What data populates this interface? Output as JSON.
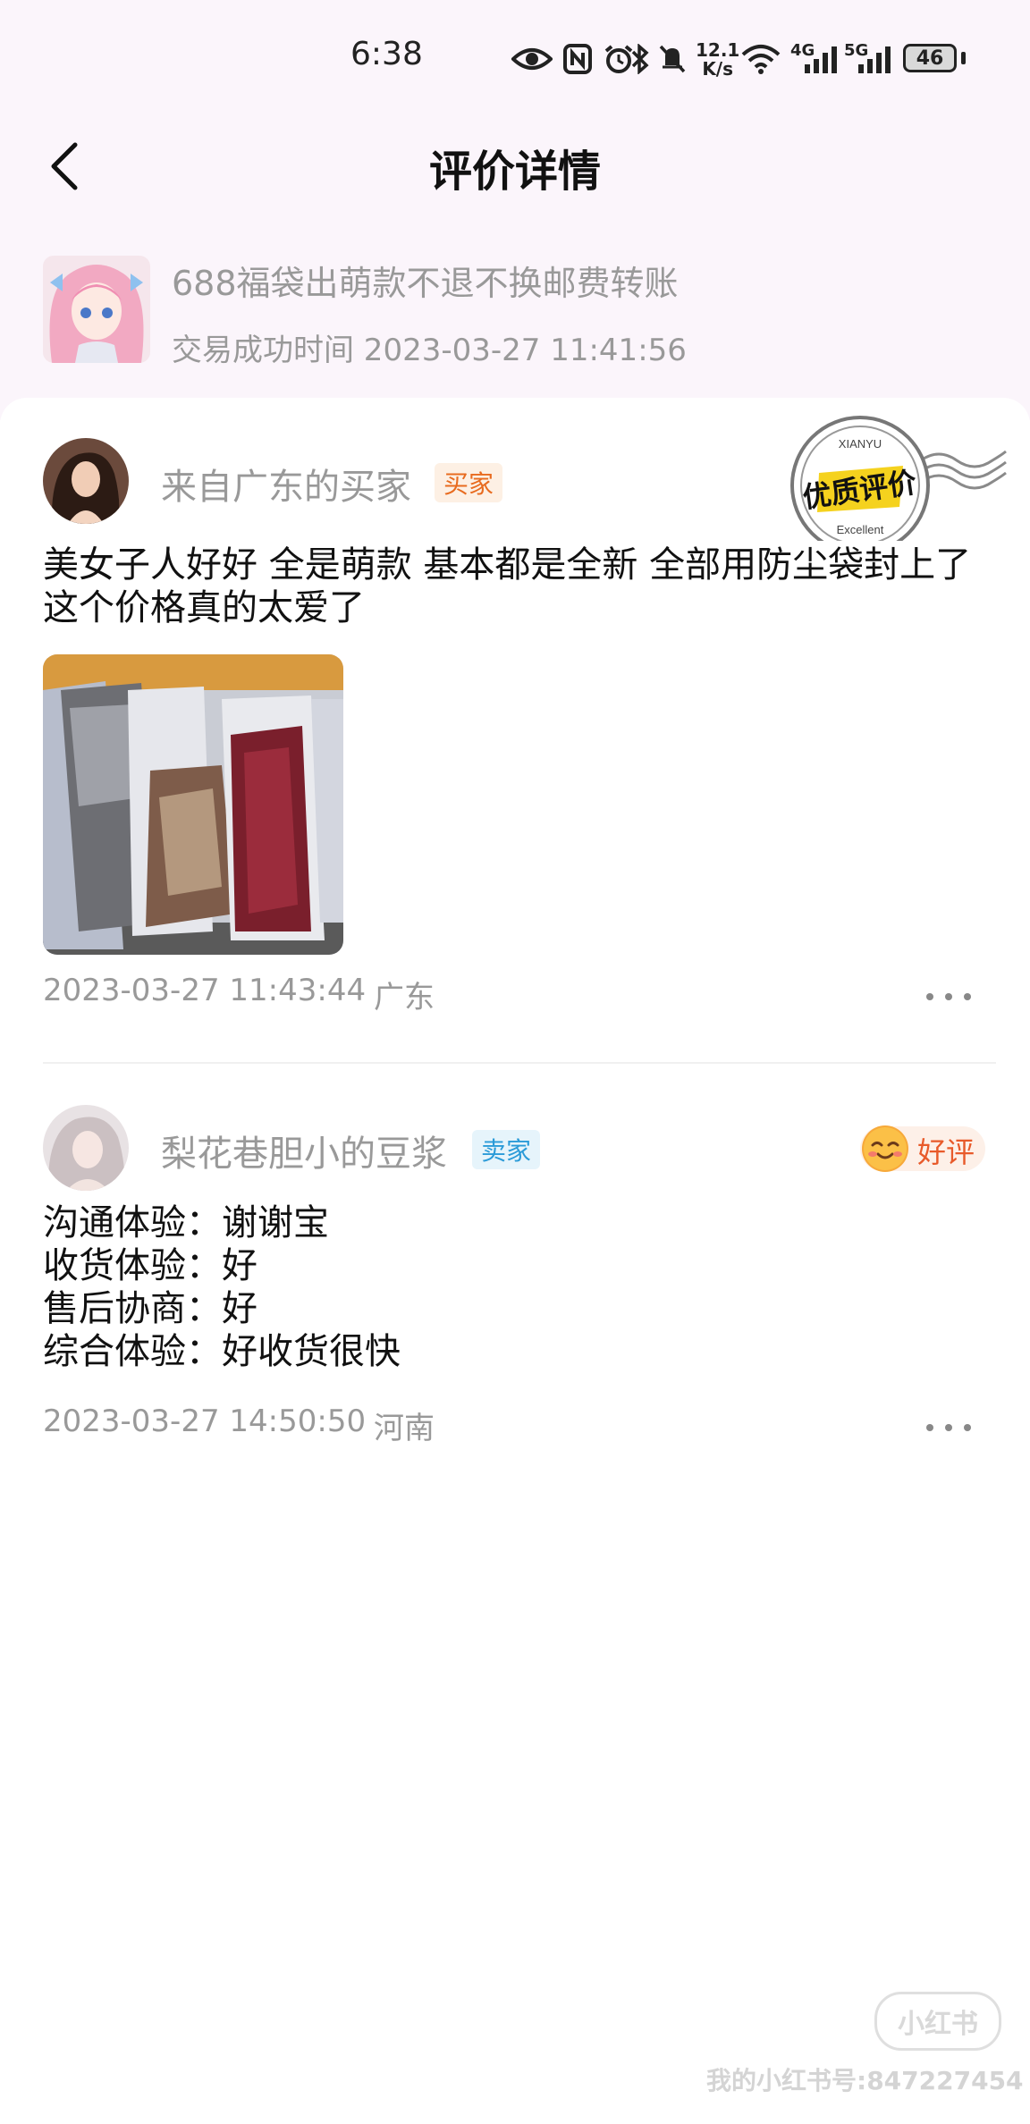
{
  "status_bar": {
    "time": "6:38",
    "net_speed_value": "12.1",
    "net_speed_unit": "K/s",
    "network_4g": "4G",
    "network_5g": "5G",
    "battery": "46",
    "icons": [
      "eye-icon",
      "nfc-icon",
      "alarm-icon",
      "bluetooth-icon",
      "mute-icon",
      "wifi-icon",
      "signal-icon",
      "battery-icon"
    ]
  },
  "header": {
    "title": "评价详情",
    "back_icon": "chevron-left-icon"
  },
  "product": {
    "name": "688福袋出萌款不退不换邮费转账",
    "success_time": "交易成功时间 2023-03-27 11:41:56"
  },
  "reviews": [
    {
      "username": "来自广东的买家",
      "role": "买家",
      "text": "美女子人好好  全是萌款 基本都是全新 全部用防尘袋封上了 这个价格真的太爱了",
      "time": "2023-03-27 11:43:44",
      "region": "广东",
      "stamp": {
        "cn": "优质评价",
        "en_top": "XIANYU",
        "en_bottom": "Excellent"
      }
    },
    {
      "username": "梨花巷胆小的豆浆",
      "role": "卖家",
      "rating": "好评",
      "lines": [
        "沟通体验：谢谢宝",
        "收货体验：好",
        "售后协商：好",
        "综合体验：好收货很快"
      ],
      "time": "2023-03-27 14:50:50",
      "region": "河南"
    }
  ],
  "watermark": {
    "logo": "小红书",
    "text": "我的小红书号:847227454"
  },
  "colors": {
    "background_top": "#fbf5fb",
    "buyer_badge": "#e86b1f",
    "seller_badge": "#2b9bd8",
    "rating": "#e85a2a",
    "stamp": "#f5d21e"
  }
}
